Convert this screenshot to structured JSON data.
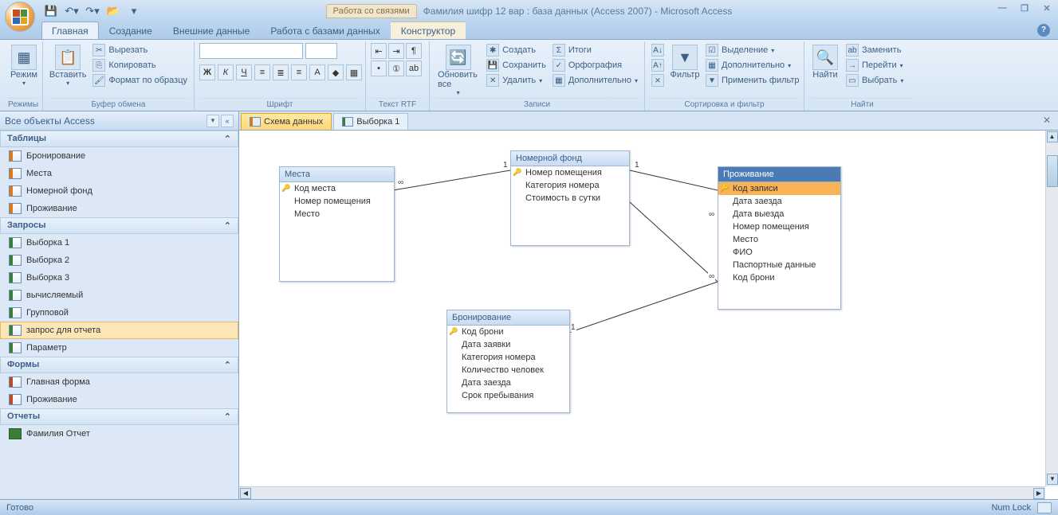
{
  "title": {
    "contextual_tab": "Работа со связями",
    "app_title": "Фамилия шифр 12 вар : база данных (Access 2007) - Microsoft Access"
  },
  "ribbon_tabs": {
    "home": "Главная",
    "create": "Создание",
    "external": "Внешние данные",
    "db_tools": "Работа с базами данных",
    "design": "Конструктор"
  },
  "ribbon": {
    "views": {
      "label": "Режим",
      "group": "Режимы"
    },
    "clipboard": {
      "paste": "Вставить",
      "cut": "Вырезать",
      "copy": "Копировать",
      "format_painter": "Формат по образцу",
      "group": "Буфер обмена"
    },
    "font": {
      "group": "Шрифт"
    },
    "richtext": {
      "group": "Текст RTF"
    },
    "records": {
      "refresh": "Обновить все",
      "new": "Создать",
      "save": "Сохранить",
      "delete": "Удалить",
      "totals": "Итоги",
      "spelling": "Орфография",
      "more": "Дополнительно",
      "group": "Записи"
    },
    "sort_filter": {
      "filter": "Фильтр",
      "selection": "Выделение",
      "advanced": "Дополнительно",
      "toggle": "Применить фильтр",
      "group": "Сортировка и фильтр"
    },
    "find_grp": {
      "find": "Найти",
      "replace": "Заменить",
      "goto": "Перейти",
      "select": "Выбрать",
      "group": "Найти"
    }
  },
  "nav": {
    "header": "Все объекты Access",
    "sections": {
      "tables": "Таблицы",
      "queries": "Запросы",
      "forms": "Формы",
      "reports": "Отчеты"
    },
    "tables": [
      "Бронирование",
      "Места",
      "Номерной фонд",
      "Проживание"
    ],
    "queries": [
      "Выборка 1",
      "Выборка 2",
      "Выборка 3",
      "вычисляемый",
      "Групповой",
      "запрос для отчета",
      "Параметр"
    ],
    "forms": [
      "Главная форма",
      "Проживание"
    ],
    "reports": [
      "Фамилия Отчет"
    ],
    "selected_query": "запрос для отчета"
  },
  "doc_tabs": {
    "schema": "Схема данных",
    "query1": "Выборка 1"
  },
  "schema": {
    "mesta": {
      "title": "Места",
      "fields": {
        "f1": "Код места",
        "f2": "Номер помещения",
        "f3": "Место"
      }
    },
    "fond": {
      "title": "Номерной фонд",
      "fields": {
        "f1": "Номер помещения",
        "f2": "Категория номера",
        "f3": "Стоимость в сутки"
      }
    },
    "proj": {
      "title": "Проживание",
      "fields": {
        "f1": "Код записи",
        "f2": "Дата заезда",
        "f3": "Дата выезда",
        "f4": "Номер помещения",
        "f5": "Место",
        "f6": "ФИО",
        "f7": "Паспортные данные",
        "f8": "Код брони"
      }
    },
    "bron": {
      "title": "Бронирование",
      "fields": {
        "f1": "Код брони",
        "f2": "Дата заявки",
        "f3": "Категория номера",
        "f4": "Количество человек",
        "f5": "Дата заезда",
        "f6": "Срок пребывания"
      }
    },
    "cardinality": {
      "one": "1",
      "many": "∞"
    }
  },
  "status": {
    "ready": "Готово",
    "numlock": "Num Lock"
  }
}
